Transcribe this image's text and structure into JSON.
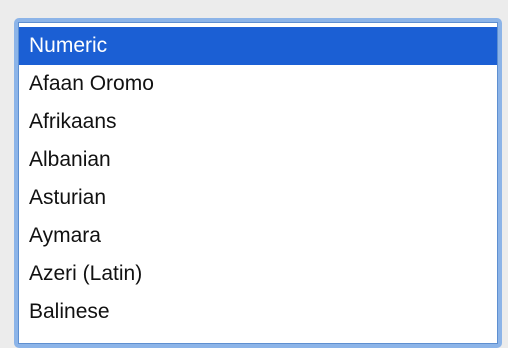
{
  "language_list": {
    "selected_index": 0,
    "accent_color": "#1b5fd4",
    "items": [
      {
        "label": "Numeric"
      },
      {
        "label": "Afaan Oromo"
      },
      {
        "label": "Afrikaans"
      },
      {
        "label": "Albanian"
      },
      {
        "label": "Asturian"
      },
      {
        "label": "Aymara"
      },
      {
        "label": "Azeri (Latin)"
      },
      {
        "label": "Balinese"
      }
    ]
  }
}
